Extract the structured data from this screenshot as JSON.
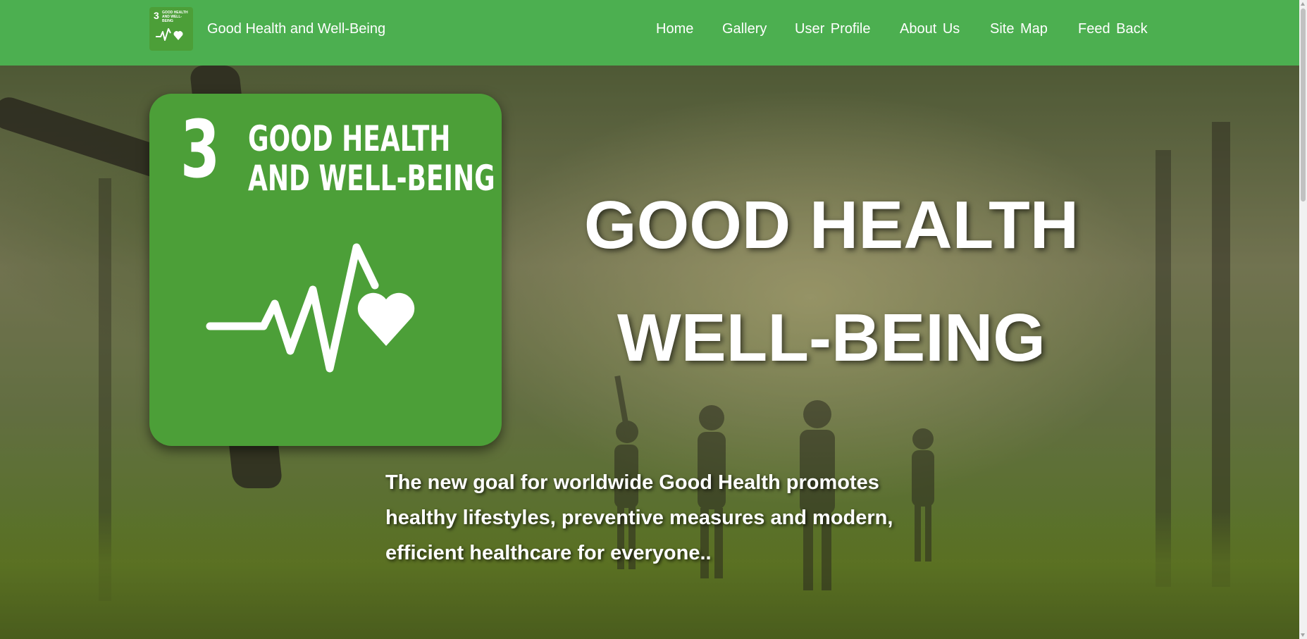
{
  "navbar": {
    "brand": "Good Health and Well-Being",
    "logo": {
      "number": "3",
      "title_line1": "GOOD HEALTH",
      "title_line2": "AND WELL-BEING"
    },
    "links": [
      {
        "label": "Home"
      },
      {
        "label": "Gallery"
      },
      {
        "label": "User  Profile"
      },
      {
        "label": "About  Us"
      },
      {
        "label": "Site  Map"
      },
      {
        "label": "Feed  Back"
      }
    ],
    "color": "#4caf50"
  },
  "hero": {
    "card": {
      "number": "3",
      "title_line1": "GOOD HEALTH",
      "title_line2": "AND WELL-BEING",
      "icon": "heartbeat-heart-icon",
      "color": "#4c9f38"
    },
    "heading_line1": "GOOD HEALTH",
    "heading_line2": "WELL-BEING",
    "description": "The new goal for worldwide Good Health promotes healthy lifestyles, preventive measures and modern, efficient healthcare for everyone..",
    "background": "family-jumping-in-park-photo"
  }
}
